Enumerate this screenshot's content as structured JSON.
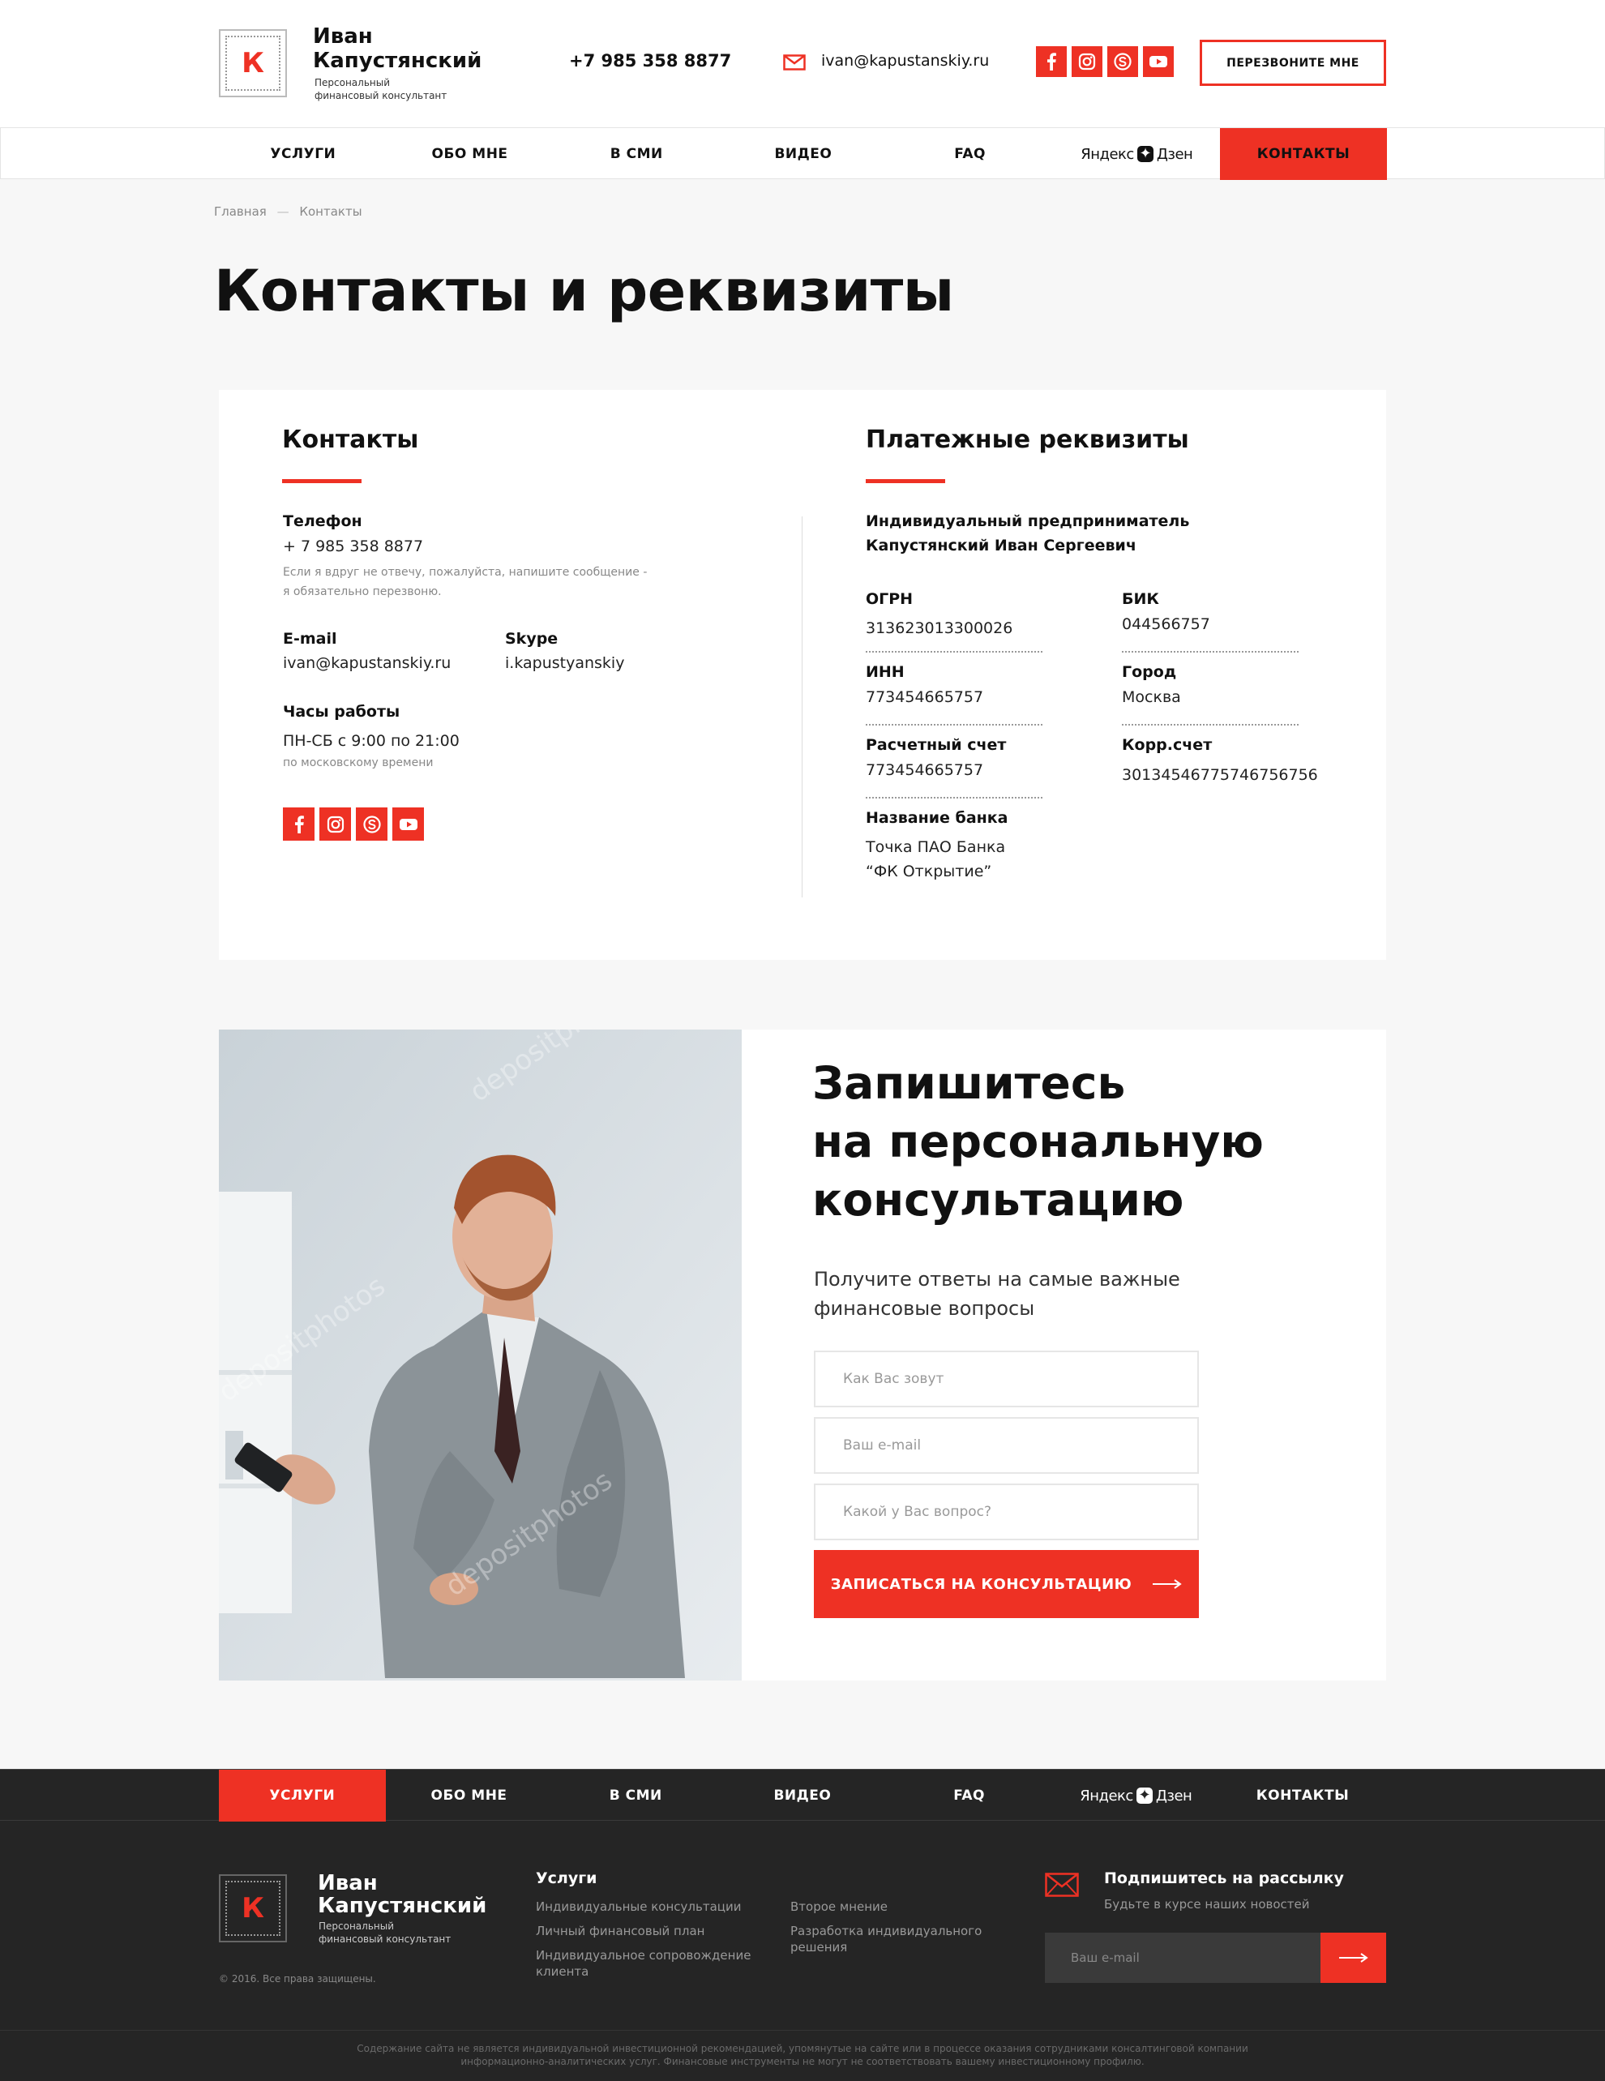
{
  "header": {
    "brand_name_1": "Иван",
    "brand_name_2": "Капустянский",
    "brand_sub_1": "Персональный",
    "brand_sub_2": "финансовый консультант",
    "logo_letter": "К",
    "phone": "+7 985 358 8877",
    "email": "ivan@kapustanskiy.ru",
    "callback_label": "ПЕРЕЗВОНИТЕ МНЕ"
  },
  "nav": {
    "items": [
      "УСЛУГИ",
      "ОБО МНЕ",
      "В СМИ",
      "ВИДЕО",
      "FAQ"
    ],
    "zen_left": "Яндекс",
    "zen_right": "Дзен",
    "contacts": "КОНТАКТЫ"
  },
  "breadcrumb": {
    "home": "Главная",
    "sep": "—",
    "current": "Контакты"
  },
  "page_title": "Контакты и реквизиты",
  "contacts": {
    "title": "Контакты",
    "phone_label": "Телефон",
    "phone_value": "+ 7 985 358 8877",
    "phone_note_1": "Если я вдруг не отвечу, пожалуйста, напишите сообщение -",
    "phone_note_2": "я обязательно перезвоню.",
    "email_label": "E-mail",
    "email_value": "ivan@kapustanskiy.ru",
    "skype_label": "Skype",
    "skype_value": "i.kapustyanskiy",
    "hours_label": "Часы работы",
    "hours_value": "ПН-СБ с 9:00 по 21:00",
    "hours_note": "по московскому времени"
  },
  "requisites": {
    "title": "Платежные реквизиты",
    "owner_1": "Индивидуальный предприниматель",
    "owner_2": "Капустянский Иван Сергеевич",
    "ogrn_label": "ОГРН",
    "ogrn_value": "313623013300026",
    "bik_label": "БИК",
    "bik_value": "044566757",
    "inn_label": "ИНН",
    "inn_value": "773454665757",
    "city_label": "Город",
    "city_value": "Москва",
    "account_label": "Расчетный счет",
    "account_value": "773454665757",
    "corr_label": "Корр.счет",
    "corr_value": "30134546775746756756",
    "bank_label": "Название банка",
    "bank_value_1": "Точка ПАО Банка",
    "bank_value_2": "“ФК Открытие”"
  },
  "consultation": {
    "title_1": "Запишитесь",
    "title_2": "на персональную",
    "title_3": "консультацию",
    "lead_1": "Получите ответы на самые важные",
    "lead_2": "финансовые вопросы",
    "name_placeholder": "Как Вас зовут",
    "email_placeholder": "Ваш e-mail",
    "question_placeholder": "Какой у Вас вопрос?",
    "submit_label": "ЗАПИСАТЬСЯ НА КОНСУЛЬТАЦИЮ",
    "watermark": "depositphotos"
  },
  "footer": {
    "services_title": "Услуги",
    "services": [
      "Индивидуальные консультации",
      "Личный финансовый план",
      "Индивидуальное сопровождение",
      "клиента",
      "Второе мнение",
      "Разработка индивидуального",
      "решения"
    ],
    "copyright": "© 2016. Все права защищены.",
    "subscribe_title": "Подпишитесь на рассылку",
    "subscribe_sub": "Будьте в курсе наших новостей",
    "subscribe_placeholder": "Ваш e-mail",
    "disclaimer_1": "Содержание сайта не является индивидуальной инвестиционной рекомендацией, упомянутые на сайте или в процессе оказания сотрудниками консалтинговой компании",
    "disclaimer_2": "информационно-аналитических услуг. Финансовые инструменты не могут не соответствовать вашему инвестиционному профилю."
  },
  "colors": {
    "accent": "#ee3124",
    "footer_bg": "#252525",
    "page_bg": "#f7f7f7"
  },
  "icons": [
    "facebook-icon",
    "instagram-icon",
    "skype-icon",
    "youtube-icon",
    "mail-icon",
    "arrow-right-icon"
  ]
}
